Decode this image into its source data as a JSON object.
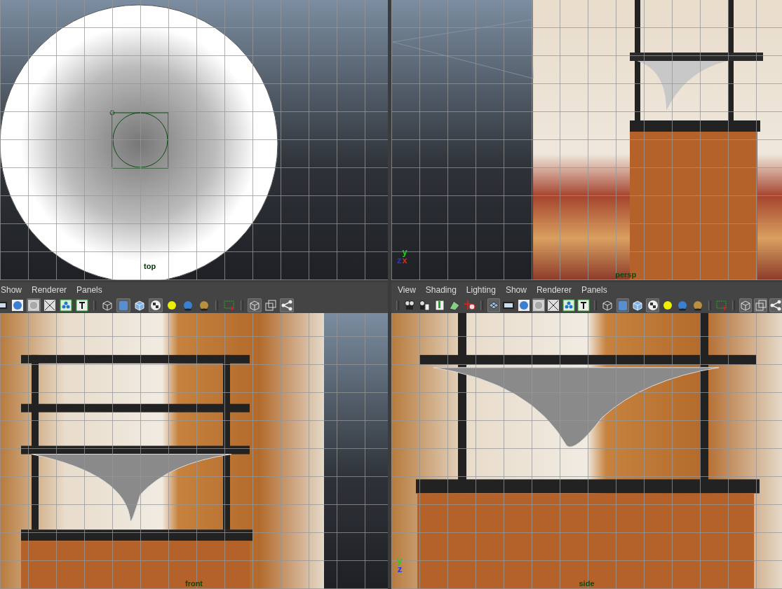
{
  "panes": [
    {
      "kind": "top",
      "label": "top"
    },
    {
      "kind": "persp",
      "label": "persp",
      "axes": [
        {
          "letter": "y",
          "color": "#22cc22"
        },
        {
          "letter": "z",
          "color": "#2233ee"
        },
        {
          "letter": "x",
          "color": "#dd2222"
        }
      ]
    },
    {
      "kind": "front",
      "label": "front",
      "menu": [
        "Show",
        "Renderer",
        "Panels"
      ],
      "toolbar": [
        {
          "kind": "film",
          "selected": false
        },
        {
          "kind": "sphere",
          "selected": false
        },
        {
          "kind": "circle",
          "selected": true
        },
        {
          "kind": "xray",
          "selected": false
        },
        {
          "kind": "dots",
          "selected": false
        },
        {
          "kind": "text",
          "selected": false
        },
        {
          "kind": "separator"
        },
        {
          "kind": "wire-cube",
          "selected": false
        },
        {
          "kind": "cube",
          "selected": true
        },
        {
          "kind": "lit-cube",
          "selected": false
        },
        {
          "kind": "checker",
          "selected": true
        },
        {
          "kind": "bulb",
          "selected": false
        },
        {
          "kind": "ball",
          "selected": false
        },
        {
          "kind": "shadow-ball",
          "selected": false
        },
        {
          "kind": "separator"
        },
        {
          "kind": "selection",
          "selected": false
        },
        {
          "kind": "separator"
        },
        {
          "kind": "box",
          "selected": true
        },
        {
          "kind": "squares",
          "selected": false
        },
        {
          "kind": "share",
          "selected": true
        }
      ]
    },
    {
      "kind": "side",
      "label": "side",
      "menu": [
        "View",
        "Shading",
        "Lighting",
        "Show",
        "Renderer",
        "Panels"
      ],
      "axes": [
        {
          "letter": "y",
          "color": "#22cc22"
        },
        {
          "letter": "z",
          "color": "#2233ee"
        }
      ],
      "toolbar": [
        {
          "kind": "separator"
        },
        {
          "kind": "camera",
          "selected": false
        },
        {
          "kind": "camera-list",
          "selected": false
        },
        {
          "kind": "book",
          "selected": false
        },
        {
          "kind": "plane",
          "selected": false
        },
        {
          "kind": "pan",
          "selected": false
        },
        {
          "kind": "separator"
        },
        {
          "kind": "grid",
          "selected": true
        },
        {
          "kind": "film",
          "selected": false
        },
        {
          "kind": "sphere",
          "selected": false
        },
        {
          "kind": "circle",
          "selected": true
        },
        {
          "kind": "xray",
          "selected": false
        },
        {
          "kind": "dots",
          "selected": false
        },
        {
          "kind": "text",
          "selected": false
        },
        {
          "kind": "separator"
        },
        {
          "kind": "wire-cube",
          "selected": false
        },
        {
          "kind": "cube",
          "selected": true
        },
        {
          "kind": "lit-cube",
          "selected": false
        },
        {
          "kind": "checker",
          "selected": true
        },
        {
          "kind": "bulb",
          "selected": false
        },
        {
          "kind": "ball",
          "selected": false
        },
        {
          "kind": "shadow-ball",
          "selected": false
        },
        {
          "kind": "separator"
        },
        {
          "kind": "selection",
          "selected": false
        },
        {
          "kind": "separator"
        },
        {
          "kind": "box",
          "selected": true
        },
        {
          "kind": "squares",
          "selected": true
        },
        {
          "kind": "share",
          "selected": true
        }
      ]
    }
  ]
}
